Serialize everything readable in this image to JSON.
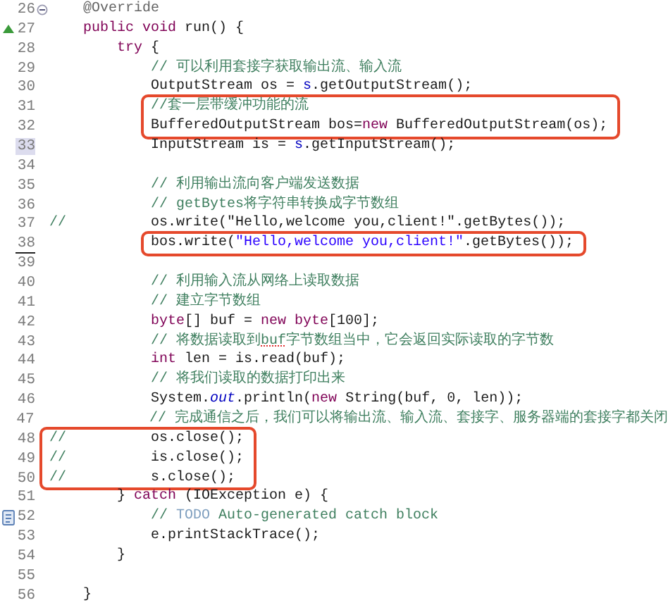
{
  "editor": {
    "lines": [
      {
        "number": "26",
        "boxed": false,
        "current": false,
        "underlined": false,
        "gutter_mark": {
          "kind": "fold"
        },
        "tokens": [
          {
            "kind": "annotation",
            "text": "    @Override"
          }
        ]
      },
      {
        "number": "27",
        "boxed": false,
        "current": false,
        "underlined": false,
        "gutter_mark": {
          "kind": "override"
        },
        "tokens": [
          {
            "kind": "keyword",
            "text": "    public void"
          },
          {
            "kind": "plain",
            "text": " run() {"
          }
        ]
      },
      {
        "number": "28",
        "boxed": false,
        "current": false,
        "underlined": false,
        "tokens": [
          {
            "kind": "keyword",
            "text": "        try"
          },
          {
            "kind": "plain",
            "text": " {"
          }
        ]
      },
      {
        "number": "29",
        "boxed": false,
        "current": false,
        "underlined": false,
        "tokens": [
          {
            "kind": "comment",
            "text": "            // 可以利用套接字获取输出流、输入流"
          }
        ]
      },
      {
        "number": "30",
        "boxed": false,
        "current": false,
        "underlined": false,
        "tokens": [
          {
            "kind": "plain",
            "text": "            OutputStream os = "
          },
          {
            "kind": "field",
            "text": "s"
          },
          {
            "kind": "plain",
            "text": ".getOutputStream();"
          }
        ]
      },
      {
        "number": "31",
        "boxed": true,
        "current": false,
        "underlined": false,
        "tokens": [
          {
            "kind": "comment",
            "text": "            //套一层带缓冲功能的流"
          }
        ]
      },
      {
        "number": "32",
        "boxed": true,
        "current": false,
        "underlined": false,
        "tokens": [
          {
            "kind": "plain",
            "text": "            BufferedOutputStream bos="
          },
          {
            "kind": "keyword",
            "text": "new"
          },
          {
            "kind": "plain",
            "text": " BufferedOutputStream(os);"
          }
        ]
      },
      {
        "number": "33",
        "boxed": false,
        "current": true,
        "underlined": false,
        "tokens": [
          {
            "kind": "plain",
            "text": "            InputStream is = "
          },
          {
            "kind": "field",
            "text": "s"
          },
          {
            "kind": "plain",
            "text": ".getInputStream();"
          }
        ]
      },
      {
        "number": "34",
        "boxed": false,
        "current": false,
        "underlined": false
      },
      {
        "number": "35",
        "boxed": false,
        "current": false,
        "underlined": false,
        "tokens": [
          {
            "kind": "comment",
            "text": "            // 利用输出流向客户端发送数据"
          }
        ]
      },
      {
        "number": "36",
        "boxed": false,
        "current": false,
        "underlined": false,
        "tokens": [
          {
            "kind": "comment",
            "text": "            // getBytes将字符串转换成字节数组"
          }
        ]
      },
      {
        "number": "37",
        "boxed": false,
        "current": false,
        "underlined": false,
        "tokens": [
          {
            "kind": "comment",
            "text": "//"
          },
          {
            "kind": "plain",
            "text": "          os.write(\"Hello,welcome you,client!\".getBytes());"
          }
        ]
      },
      {
        "number": "38",
        "boxed": true,
        "current": false,
        "underlined": true,
        "tokens": [
          {
            "kind": "plain",
            "text": "            bos.write("
          },
          {
            "kind": "string",
            "text": "\"Hello,welcome you,client!\""
          },
          {
            "kind": "plain",
            "text": ".getBytes());"
          }
        ]
      },
      {
        "number": "39",
        "boxed": false,
        "current": false,
        "underlined": false
      },
      {
        "number": "40",
        "boxed": false,
        "current": false,
        "underlined": false,
        "tokens": [
          {
            "kind": "comment",
            "text": "            // 利用输入流从网络上读取数据"
          }
        ]
      },
      {
        "number": "41",
        "boxed": false,
        "current": false,
        "underlined": false,
        "tokens": [
          {
            "kind": "comment",
            "text": "            // 建立字节数组"
          }
        ]
      },
      {
        "number": "42",
        "boxed": false,
        "current": false,
        "underlined": false,
        "tokens": [
          {
            "kind": "keyword",
            "text": "            byte"
          },
          {
            "kind": "plain",
            "text": "[] buf = "
          },
          {
            "kind": "keyword",
            "text": "new byte"
          },
          {
            "kind": "plain",
            "text": "[100];"
          }
        ]
      },
      {
        "number": "43",
        "boxed": false,
        "current": false,
        "underlined": false,
        "tokens": [
          {
            "kind": "comment",
            "text": "            // 将数据读取到"
          },
          {
            "kind": "misspelled",
            "text": "buf"
          },
          {
            "kind": "comment",
            "text": "字节数组当中，它会返回实际读取的字节数"
          }
        ]
      },
      {
        "number": "44",
        "boxed": false,
        "current": false,
        "underlined": false,
        "tokens": [
          {
            "kind": "keyword",
            "text": "            int"
          },
          {
            "kind": "plain",
            "text": " len = is.read(buf);"
          }
        ]
      },
      {
        "number": "45",
        "boxed": false,
        "current": false,
        "underlined": false,
        "tokens": [
          {
            "kind": "comment",
            "text": "            // 将我们读取的数据打印出来"
          }
        ]
      },
      {
        "number": "46",
        "boxed": false,
        "current": false,
        "underlined": false,
        "tokens": [
          {
            "kind": "plain",
            "text": "            System."
          },
          {
            "kind": "static",
            "text": "out"
          },
          {
            "kind": "plain",
            "text": ".println("
          },
          {
            "kind": "keyword",
            "text": "new"
          },
          {
            "kind": "plain",
            "text": " String(buf, 0, len));"
          }
        ]
      },
      {
        "number": "47",
        "boxed": false,
        "current": false,
        "underlined": false,
        "tokens": [
          {
            "kind": "comment",
            "text": "            // 完成通信之后，我们可以将输出流、输入流、套接字、服务器端的套接字都关闭"
          }
        ]
      },
      {
        "number": "48",
        "boxed": true,
        "current": false,
        "underlined": false,
        "tokens": [
          {
            "kind": "comment",
            "text": "//"
          },
          {
            "kind": "plain",
            "text": "          os.close();"
          }
        ]
      },
      {
        "number": "49",
        "boxed": true,
        "current": false,
        "underlined": false,
        "tokens": [
          {
            "kind": "comment",
            "text": "//"
          },
          {
            "kind": "plain",
            "text": "          is.close();"
          }
        ]
      },
      {
        "number": "50",
        "boxed": true,
        "current": false,
        "underlined": false,
        "tokens": [
          {
            "kind": "comment",
            "text": "//"
          },
          {
            "kind": "plain",
            "text": "          s.close();"
          }
        ]
      },
      {
        "number": "51",
        "boxed": false,
        "current": false,
        "underlined": false,
        "tokens": [
          {
            "kind": "plain",
            "text": "        } "
          },
          {
            "kind": "keyword",
            "text": "catch"
          },
          {
            "kind": "plain",
            "text": " (IOException e) {"
          }
        ]
      },
      {
        "number": "52",
        "boxed": false,
        "current": false,
        "underlined": false,
        "gutter_mark": {
          "kind": "task"
        },
        "tokens": [
          {
            "kind": "comment",
            "text": "            // "
          },
          {
            "kind": "todo",
            "text": "TODO"
          },
          {
            "kind": "comment",
            "text": " Auto-generated catch block"
          }
        ]
      },
      {
        "number": "53",
        "boxed": false,
        "current": false,
        "underlined": false,
        "tokens": [
          {
            "kind": "plain",
            "text": "            e.printStackTrace();"
          }
        ]
      },
      {
        "number": "54",
        "boxed": false,
        "current": false,
        "underlined": false,
        "tokens": [
          {
            "kind": "plain",
            "text": "        }"
          }
        ]
      },
      {
        "number": "55",
        "boxed": false,
        "current": false,
        "underlined": false
      },
      {
        "number": "56",
        "boxed": false,
        "current": false,
        "underlined": false,
        "tokens": [
          {
            "kind": "plain",
            "text": "    }"
          }
        ]
      }
    ]
  }
}
